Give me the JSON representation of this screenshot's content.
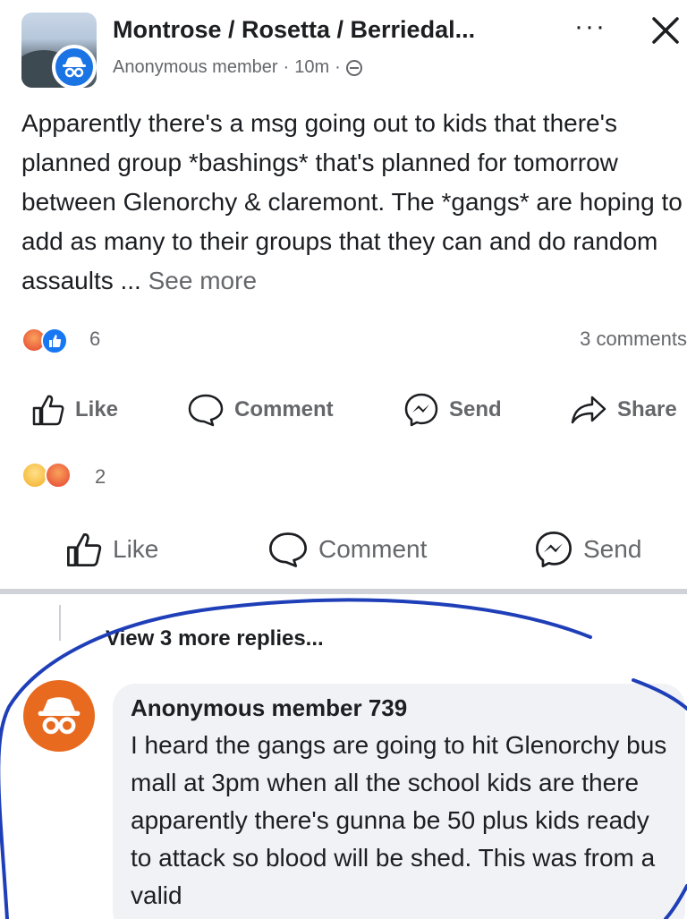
{
  "header": {
    "group_name": "Montrose / Rosetta / Berriedal...",
    "author": "Anonymous member",
    "time": "10m",
    "more_icon": "more-horizontal-icon",
    "close_icon": "close-icon"
  },
  "post": {
    "text": "Apparently there's a msg going out to kids that there's planned group *bashings* that's planned for tomorrow between Glenorchy & claremont. The *gangs* are hoping to add as many to their groups that they can and do random assaults ...",
    "see_more": "See more",
    "reaction_count": "6",
    "comments_count": "3 comments",
    "actions": {
      "like": "Like",
      "comment": "Comment",
      "send": "Send",
      "share": "Share"
    }
  },
  "comment_section": {
    "reaction_count": "2",
    "actions": {
      "like": "Like",
      "comment": "Comment",
      "send": "Send"
    },
    "view_more_replies": "View 3 more replies...",
    "reply": {
      "author": "Anonymous member 739",
      "text": "I heard the gangs are going to hit Glenorchy bus mall at 3pm when all the school kids are there apparently there's gunna be 50 plus kids ready to attack so blood will be shed. This was from a valid"
    }
  },
  "colors": {
    "primary_text": "#1c1e21",
    "secondary_text": "#65676b",
    "facebook_blue": "#1877f2",
    "avatar_orange": "#e76a1e",
    "annotation_ink": "#1f3fb8",
    "bubble_bg": "#f0f2f5"
  }
}
